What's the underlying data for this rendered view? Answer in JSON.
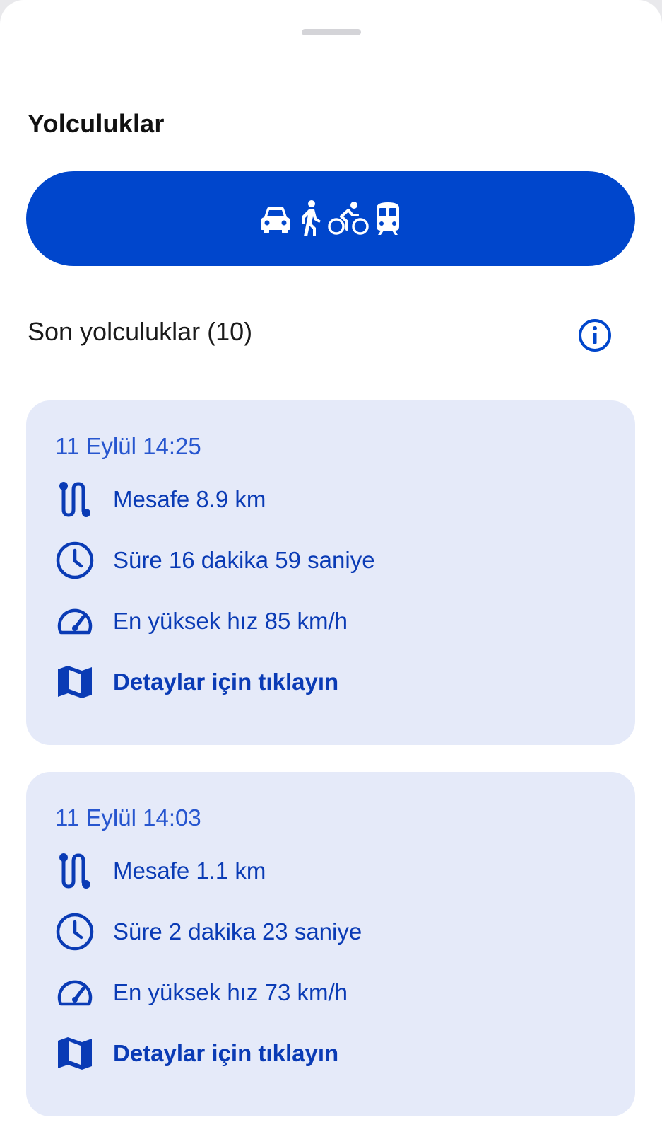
{
  "header": {
    "title": "Yolculuklar"
  },
  "modes": [
    {
      "icon": "car-icon"
    },
    {
      "icon": "walking-icon"
    },
    {
      "icon": "bicycle-icon"
    },
    {
      "icon": "train-icon"
    }
  ],
  "section": {
    "title": "Son yolculuklar (10)",
    "info_icon": "info-icon"
  },
  "trips": [
    {
      "date": "11 Eylül 14:25",
      "distance": "Mesafe 8.9 km",
      "duration": "Süre 16 dakika 59 saniye",
      "max_speed": "En yüksek hız 85 km/h",
      "details": "Detaylar için tıklayın"
    },
    {
      "date": "11 Eylül 14:03",
      "distance": "Mesafe 1.1 km",
      "duration": "Süre 2 dakika 23 saniye",
      "max_speed": "En yüksek hız 73 km/h",
      "details": "Detaylar için tıklayın"
    }
  ],
  "colors": {
    "primary": "#0046cc",
    "card_background": "#e5eaf9",
    "card_text": "#0a3bb5",
    "date_text": "#2756cf"
  }
}
